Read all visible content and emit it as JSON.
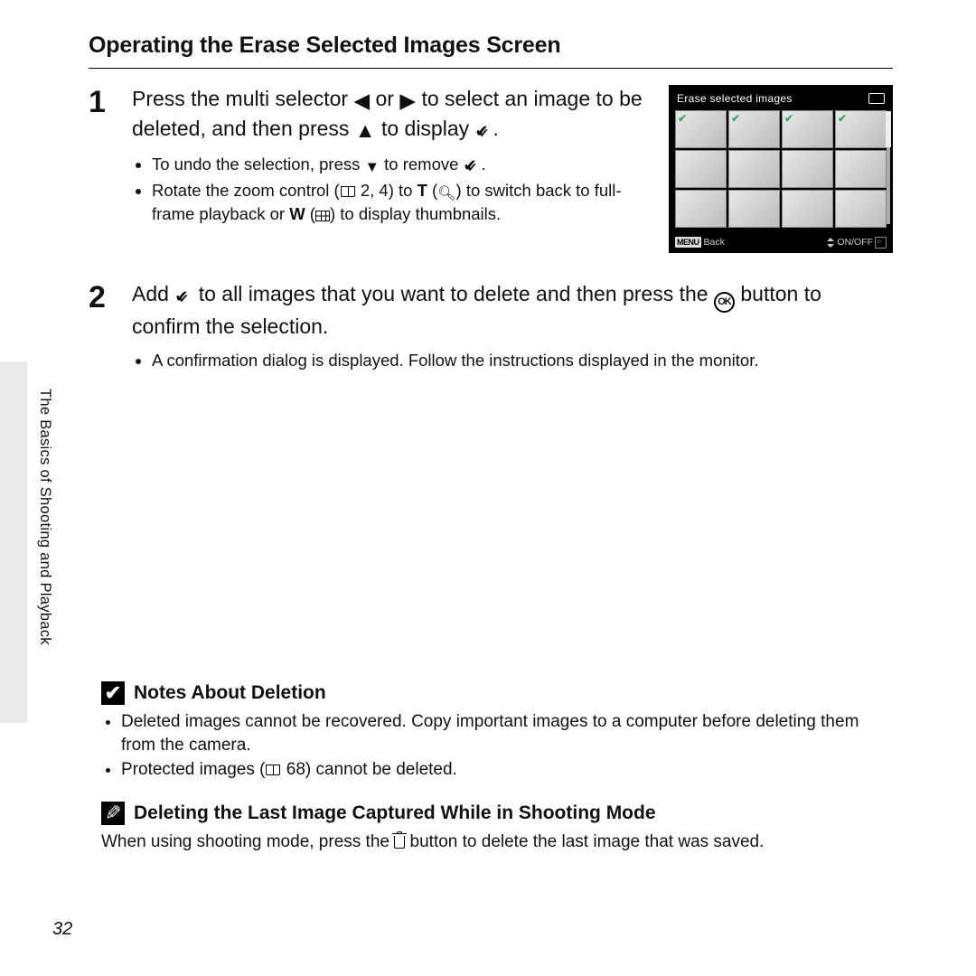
{
  "section_title": "Operating the Erase Selected Images Screen",
  "sidebar_label": "The Basics of Shooting and Playback",
  "page_number": "32",
  "step1": {
    "num": "1",
    "head_a": "Press the multi selector ",
    "head_b": " or ",
    "head_c": " to select an image to be deleted, and then press ",
    "head_d": " to display ",
    "head_e": ".",
    "bullets": {
      "b1a": "To undo the selection, press ",
      "b1b": " to remove ",
      "b1c": ".",
      "b2a": "Rotate the zoom control (",
      "b2b": " 2, 4) to ",
      "b2c": "T",
      "b2d": " (",
      "b2e": ") to switch back to full-frame playback or ",
      "b2f": "W",
      "b2g": " (",
      "b2h": ") to display thumbnails."
    }
  },
  "cam": {
    "title": "Erase selected images",
    "footer_back": "Back",
    "footer_onoff": "ON/OFF"
  },
  "step2": {
    "num": "2",
    "head_a": "Add ",
    "head_b": " to all images that you want to delete and then press the ",
    "head_c": " button to confirm the selection.",
    "ok_label": "OK",
    "bullet": "A confirmation dialog is displayed. Follow the instructions displayed in the monitor."
  },
  "notes1": {
    "title": "Notes About Deletion",
    "b1": "Deleted images cannot be recovered. Copy important images to a computer before deleting them from the camera.",
    "b2a": "Protected images (",
    "b2b": " 68) cannot be deleted."
  },
  "notes2": {
    "title": "Deleting the Last Image Captured While in Shooting Mode",
    "p_a": "When using shooting mode, press the ",
    "p_b": " button to delete the last image that was saved."
  }
}
